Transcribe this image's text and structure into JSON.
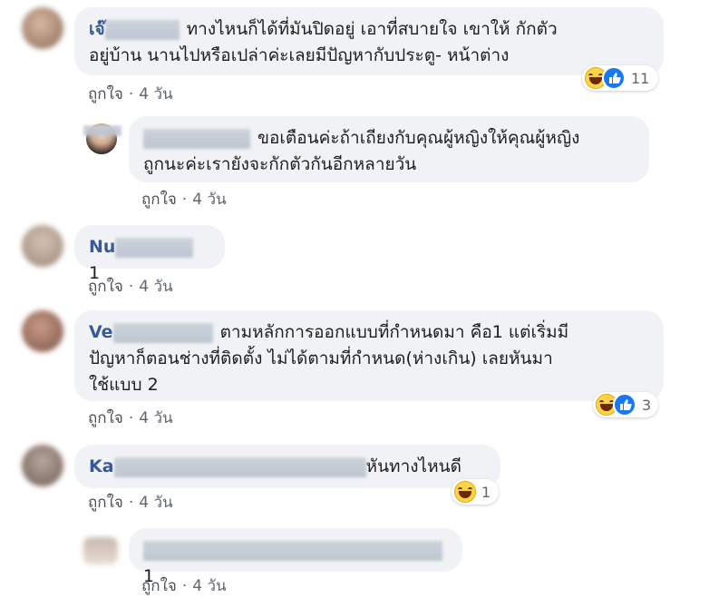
{
  "comments": [
    {
      "name_visible": "เจ๊",
      "text_lines": [
        "ทางไหนก็ได้ที่มันปิดอยู่ เอาที่สบายใจ เขาให้ กักตัว",
        "อยู่บ้าน นานไปหรือเปล่าค่ะเลยมีปัญหากับประตู- หน้าต่าง"
      ],
      "like_label": "ถูกใจ",
      "time": "4 วัน",
      "reaction_count": "11"
    },
    {
      "text_lines": [
        "ขอเตือนค่ะถ้าเถียงกับคุณผู้หญิงให้คุณผู้หญิง",
        "ถูกนะค่ะเรายังจะกักตัวกันอีกหลายวัน"
      ],
      "like_label": "ถูกใจ",
      "time": "4 วัน"
    },
    {
      "name_visible": "Nu",
      "text": "1",
      "like_label": "ถูกใจ",
      "time": "4 วัน"
    },
    {
      "name_visible": "Ve",
      "text_lines": [
        "ตามหลักการออกแบบที่กำหนดมา คือ1 แต่เริ่มมี",
        "ปัญหาก็ตอนช่างที่ติดตั้ง ไม่ได้ตามที่กำหนด(ห่างเกิน) เลยหันมา",
        "ใช้แบบ 2"
      ],
      "like_label": "ถูกใจ",
      "time": "4 วัน",
      "reaction_count": "3"
    },
    {
      "name_visible": "Ka",
      "text": "หันทางไหนดี",
      "like_label": "ถูกใจ",
      "time": "4 วัน",
      "reaction_count": "1"
    },
    {
      "text": "1",
      "like_label": "ถูกใจ",
      "time": "4 วัน"
    }
  ],
  "dot": "·",
  "icons": {
    "haha": "haha-reaction-icon",
    "like": "like-reaction-icon"
  },
  "colors": {
    "bubble": "#f0f2f5",
    "name": "#385898",
    "meta": "#606770",
    "like_blue": "#1877f2"
  }
}
